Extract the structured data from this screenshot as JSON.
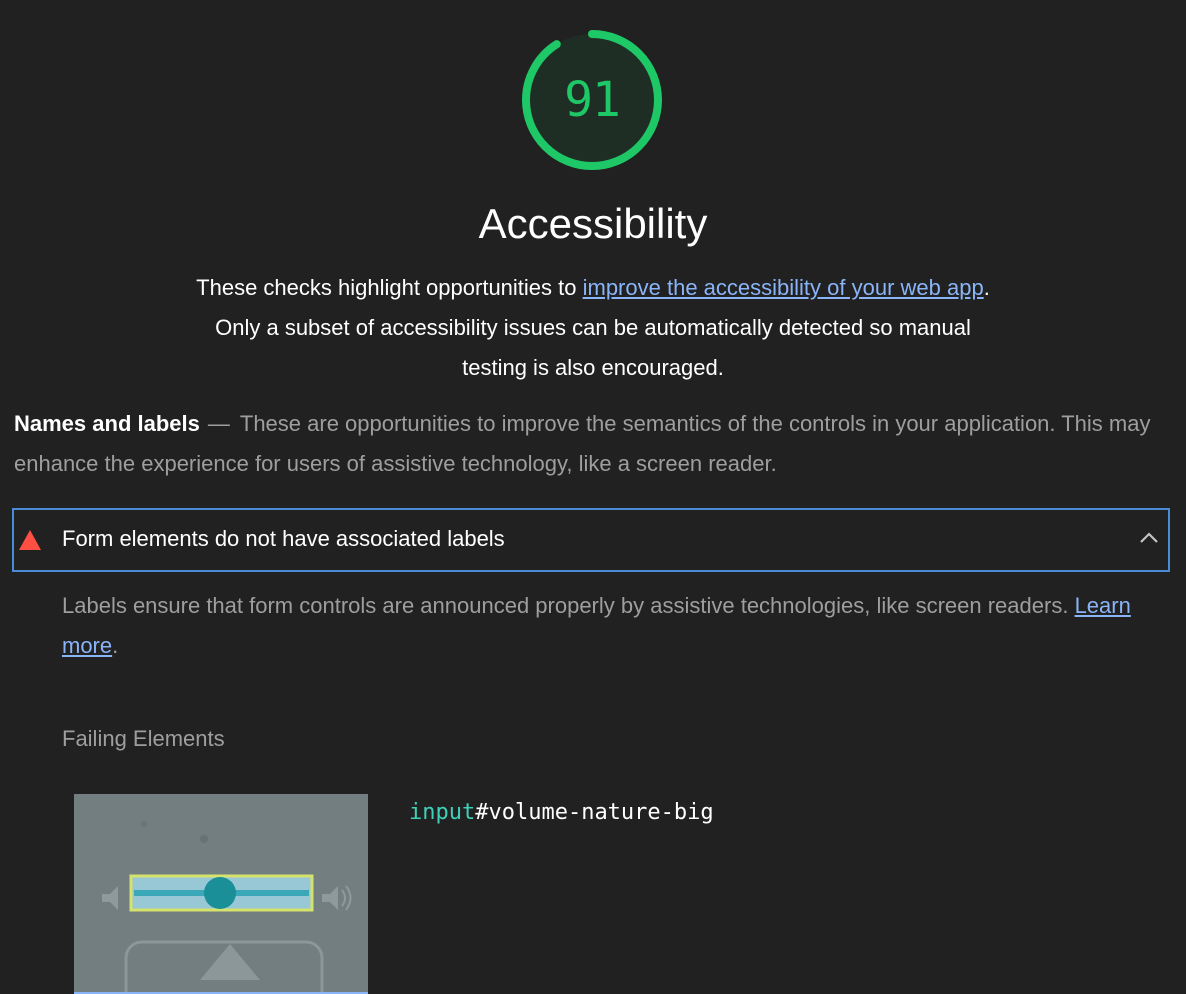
{
  "score": {
    "value": "91",
    "fraction": 0.91,
    "color": "#1fc866"
  },
  "category": {
    "title": "Accessibility",
    "description_pre": "These checks highlight opportunities to ",
    "description_link": "improve the accessibility of your web app",
    "description_post": ". Only a subset of accessibility issues can be automatically detected so manual testing is also encouraged."
  },
  "group": {
    "title": "Names and labels",
    "separator": "—",
    "description": "These are opportunities to improve the semantics of the controls in your application. This may enhance the experience for users of assistive technology, like a screen reader."
  },
  "audit": {
    "status_icon": "fail-triangle-icon",
    "status_color": "#ff4e42",
    "title": "Form elements do not have associated labels",
    "expanded": true,
    "description_pre": "Labels ensure that form controls are announced properly by assistive technologies, like screen readers. ",
    "learn_more": "Learn more",
    "description_post": ".",
    "failing_label": "Failing Elements",
    "failing_items": [
      {
        "selector_tag": "input",
        "selector_rest": "#volume-nature-big"
      }
    ]
  },
  "colors": {
    "background": "#212121",
    "link": "#8ab4f8",
    "focus_border": "#4a8bd6",
    "highlight": "#d5e26b",
    "selector_tag": "#3fd0b8"
  }
}
